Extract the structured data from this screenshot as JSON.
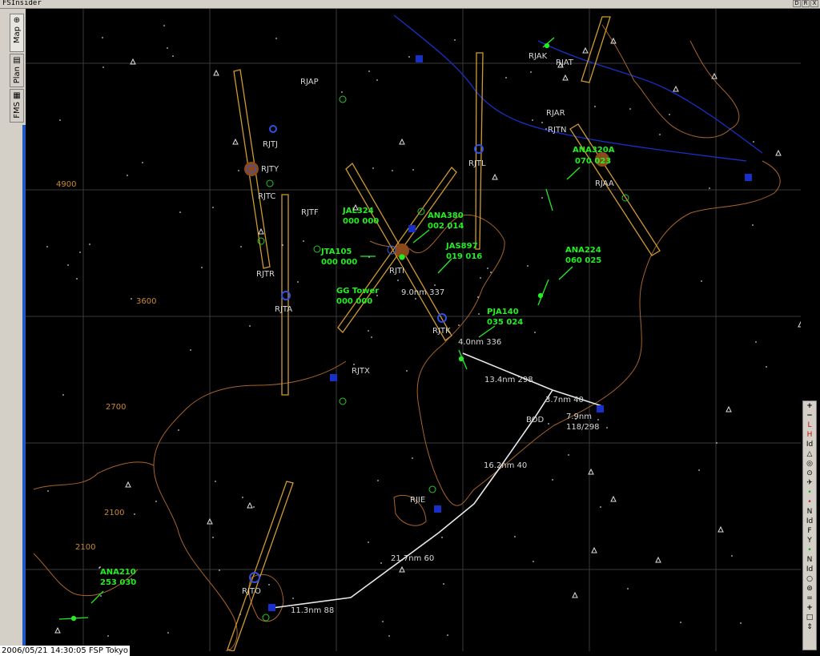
{
  "window": {
    "title": "FSInsider",
    "buttons": [
      "D",
      "R",
      "X"
    ]
  },
  "tabs": [
    {
      "label": "Map",
      "icon": "globe-icon"
    },
    {
      "label": "Plan",
      "icon": "document-icon"
    },
    {
      "label": "FMS",
      "icon": "calculator-icon"
    }
  ],
  "status": "2006/05/21 14:30:05 FSP Tokyo",
  "airports": [
    {
      "id": "RJAP",
      "label": "RJAP"
    },
    {
      "id": "RJAA",
      "label": "RJAA"
    },
    {
      "id": "RJAT",
      "label": "RJAT"
    },
    {
      "id": "RJAK",
      "label": "RJAK"
    },
    {
      "id": "RJAR",
      "label": "RJAR"
    },
    {
      "id": "RJTN",
      "label": "RJTN"
    },
    {
      "id": "RJTJ",
      "label": "RJTJ"
    },
    {
      "id": "RJTY",
      "label": "RJTY"
    },
    {
      "id": "RJTC",
      "label": "RJTC"
    },
    {
      "id": "RJTF",
      "label": "RJTF"
    },
    {
      "id": "RJTL",
      "label": "RJTL"
    },
    {
      "id": "RJTI",
      "label": "RJTI"
    },
    {
      "id": "RJTR",
      "label": "RJTR"
    },
    {
      "id": "RJTA",
      "label": "RJTA"
    },
    {
      "id": "RJTK",
      "label": "RJTK"
    },
    {
      "id": "RJTX",
      "label": "RJTX"
    },
    {
      "id": "RJIE",
      "label": "RJIE"
    },
    {
      "id": "RJTO",
      "label": "RJTO"
    },
    {
      "id": "BOD",
      "label": "BOD"
    }
  ],
  "altitudes": [
    "4900",
    "3600",
    "2700",
    "2100",
    "2100"
  ],
  "traffic": [
    {
      "callsign": "ANA320A",
      "data": "070  023"
    },
    {
      "callsign": "JAL324",
      "data": "000  000"
    },
    {
      "callsign": "ANA380",
      "data": "002  014"
    },
    {
      "callsign": "JAS897",
      "data": "019  016"
    },
    {
      "callsign": "JTA105",
      "data": "000  000"
    },
    {
      "callsign": "ANA224",
      "data": "060  025"
    },
    {
      "callsign": "GG Tower",
      "data": "000  000"
    },
    {
      "callsign": "PJA140",
      "data": "035  024"
    },
    {
      "callsign": "ANA210",
      "data": "253  030"
    }
  ],
  "legs": [
    "9.0nm 337",
    "4.0nm 336",
    "13.4nm 298",
    "3.7nm 40",
    "7.9nm",
    "118/298",
    "16.2nm 40",
    "21.7nm 60",
    "11.3nm 88"
  ],
  "toolbar": [
    "+",
    "−",
    "L",
    "H",
    "Id",
    "△",
    "◎",
    "⊙",
    "✈",
    "•",
    "•",
    "N",
    "Id",
    "F",
    "Y",
    "•",
    "N",
    "Id",
    "○",
    "⊚",
    "=",
    "+",
    "□",
    "⇕"
  ],
  "colors": {
    "coast": "#a8642a",
    "river": "#1830c8",
    "traffic": "#22ee22",
    "runway": "#d09a30",
    "route": "#e8e8e8",
    "grid": "#3a3a3a"
  }
}
